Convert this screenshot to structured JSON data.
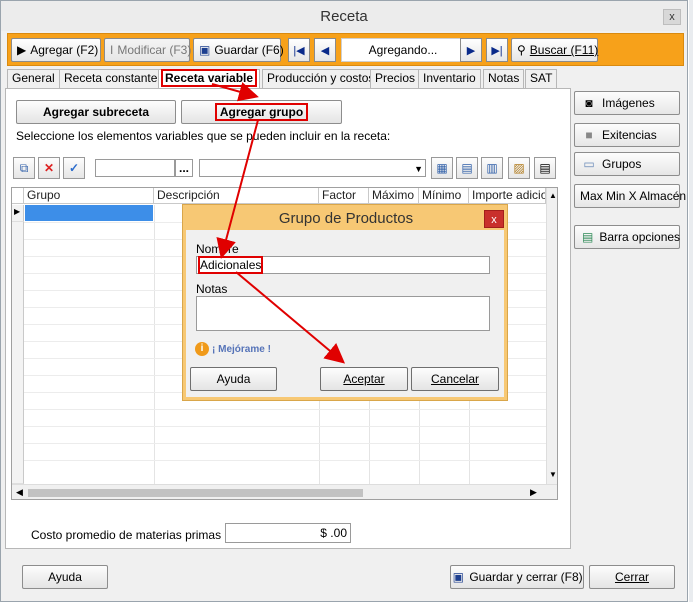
{
  "window": {
    "title": "Receta",
    "close_label": "x"
  },
  "toolbar": {
    "agregar": "Agregar (F2)",
    "modificar": "Modificar (F3)",
    "guardar": "Guardar (F6)",
    "status": "Agregando...",
    "buscar": "Buscar (F11)"
  },
  "tabs": [
    "General",
    "Receta constante",
    "Receta variable",
    "Producción y costos",
    "Precios",
    "Inventario",
    "Notas",
    "SAT"
  ],
  "panel": {
    "agregar_subreceta": "Agregar subreceta",
    "agregar_grupo": "Agregar grupo",
    "instructions": "Seleccione los elementos variables que se pueden incluir en la receta:",
    "lookup_button": "...",
    "grid_columns": [
      "Grupo",
      "Descripción",
      "Factor",
      "Máximo",
      "Mínimo",
      "Importe adicion"
    ],
    "costo_label": "Costo promedio de materias primas",
    "costo_value": "$ .00"
  },
  "side_buttons": [
    "Imágenes",
    "Exitencias",
    "Grupos",
    "Max Min X Almacén",
    "Barra opciones"
  ],
  "footer": {
    "ayuda": "Ayuda",
    "guardar_cerrar": "Guardar y cerrar (F8)",
    "cerrar": "Cerrar"
  },
  "dialog": {
    "title": "Grupo de Productos",
    "close_label": "x",
    "nombre_label": "Nombre",
    "nombre_value": "Adicionales",
    "notas_label": "Notas",
    "notas_value": "",
    "mejorame": "¡ Mejórame !",
    "ayuda": "Ayuda",
    "aceptar": "Aceptar",
    "cancelar": "Cancelar"
  },
  "colors": {
    "toolbar": "#f7a11a",
    "dialog_border": "#f7c874",
    "annotation": "#e00000",
    "selected_cell": "#3d8ee8"
  }
}
